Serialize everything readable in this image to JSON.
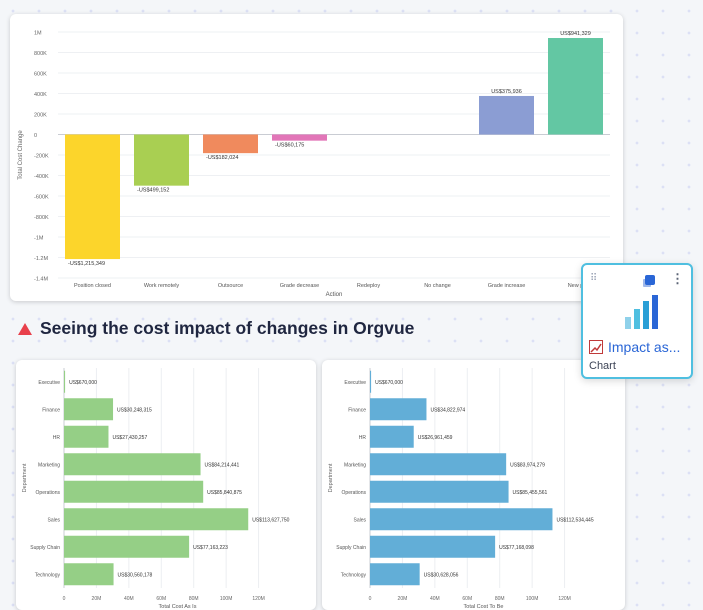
{
  "headline": "Seeing the cost impact of changes in Orgvue",
  "widget": {
    "title": "Impact as...",
    "subtitle": "Chart",
    "icon": "bar-chart-icon"
  },
  "colors": {
    "accent": "#2a66d6",
    "border": "#4fbfe0",
    "headline_icon": "#e8404b"
  },
  "chart_data": [
    {
      "type": "waterfall",
      "xlabel": "Action",
      "ylabel": "Total Cost Change",
      "categories": [
        "Position closed",
        "Work remotely",
        "Outsource",
        "Grade decrease",
        "Redeploy",
        "No change",
        "Grade increase",
        "New p"
      ],
      "values": [
        -1215349,
        -499152,
        -182024,
        -60175,
        0,
        0,
        375936,
        941329
      ],
      "labels": [
        "-US$1,215,349",
        "-US$499,152",
        "-US$182,024",
        "-US$60,175",
        "",
        "",
        "US$375,936",
        "US$941,329"
      ],
      "colors": [
        "#fcd52b",
        "#a9cf52",
        "#f08a5d",
        "#e276b8",
        "#cccccc",
        "#cccccc",
        "#8b9dd3",
        "#63c7a3"
      ],
      "ylim": [
        -1400000,
        1000000
      ],
      "yticks": [
        1000000,
        800000,
        600000,
        400000,
        200000,
        0,
        -200000,
        -400000,
        -600000,
        -800000,
        -1000000,
        -1200000,
        -1400000
      ],
      "ytick_labels": [
        "1M",
        "800K",
        "600K",
        "400K",
        "200K",
        "0",
        "-200K",
        "-400K",
        "-600K",
        "-800K",
        "-1M",
        "-1.2M",
        "-1.4M"
      ],
      "grid": true
    },
    {
      "type": "bar",
      "orientation": "horizontal",
      "xlabel": "Total Cost As Is",
      "ylabel": "Department",
      "categories": [
        "Executive",
        "Finance",
        "HR",
        "Marketing",
        "Operations",
        "Sales",
        "Supply Chain",
        "Technology"
      ],
      "values": [
        670000,
        30248315,
        27430257,
        84214441,
        85840875,
        113627750,
        77163223,
        30560178
      ],
      "labels": [
        "US$670,000",
        "US$30,248,315",
        "US$27,430,257",
        "US$84,214,441",
        "US$85,840,875",
        "US$113,627,750",
        "US$77,163,223",
        "US$30,560,178"
      ],
      "color": "#95cf86",
      "xlim": [
        0,
        140000000
      ],
      "xticks": [
        0,
        20000000,
        40000000,
        60000000,
        80000000,
        100000000,
        120000000
      ],
      "xtick_labels": [
        "0",
        "20M",
        "40M",
        "60M",
        "80M",
        "100M",
        "120M"
      ],
      "grid": true
    },
    {
      "type": "bar",
      "orientation": "horizontal",
      "xlabel": "Total Cost To Be",
      "ylabel": "Department",
      "categories": [
        "Executive",
        "Finance",
        "HR",
        "Marketing",
        "Operations",
        "Sales",
        "Supply Chain",
        "Technology"
      ],
      "values": [
        670000,
        34822974,
        26961459,
        83974279,
        85455561,
        112534445,
        77168098,
        30628056
      ],
      "labels": [
        "US$670,000",
        "US$34,822,974",
        "US$26,961,459",
        "US$83,974,279",
        "US$85,455,561",
        "US$112,534,445",
        "US$77,168,098",
        "US$30,628,056"
      ],
      "color": "#62aed7",
      "xlim": [
        0,
        140000000
      ],
      "xticks": [
        0,
        20000000,
        40000000,
        60000000,
        80000000,
        100000000,
        120000000
      ],
      "xtick_labels": [
        "0",
        "20M",
        "40M",
        "60M",
        "80M",
        "100M",
        "120M"
      ],
      "grid": true
    }
  ]
}
